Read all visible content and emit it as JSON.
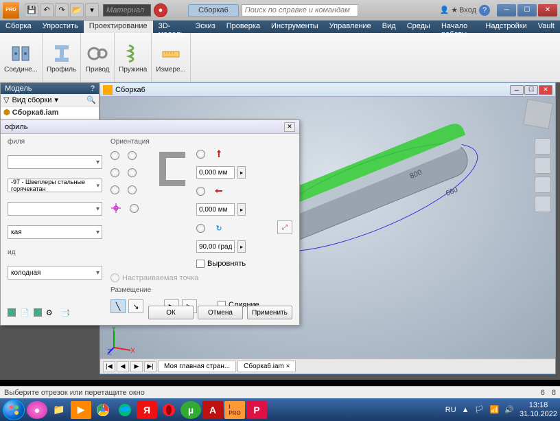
{
  "titlebar": {
    "material_placeholder": "Материал",
    "doc_tab": "Сборка6",
    "search_placeholder": "Поиск по справке и командам",
    "signin": "Вход"
  },
  "menus": [
    "Сборка",
    "Упростить",
    "Проектирование",
    "3D-модель",
    "Эскиз",
    "Проверка",
    "Инструменты",
    "Управление",
    "Вид",
    "Среды",
    "Начало работы",
    "Надстройки",
    "Vault"
  ],
  "active_menu": "Проектирование",
  "ribbon": [
    {
      "label": "Соедине..."
    },
    {
      "label": "Профиль"
    },
    {
      "label": "Привод"
    },
    {
      "label": "Пружина"
    },
    {
      "label": "Измере..."
    }
  ],
  "model_panel": {
    "title": "Модель",
    "view_label": "Вид сборки",
    "root": "Сборка6.iam"
  },
  "child_win": {
    "title": "Сборка6",
    "tabs_nav": [
      "|◀",
      "◀",
      "▶",
      "▶|"
    ],
    "tabs": [
      "Моя главная стран...",
      "Сборка6.iam ×"
    ]
  },
  "dialog": {
    "title": "офиль",
    "left_label": "филя",
    "combo_standard": "-97 - Швеллеры стальные горячекатан",
    "combo_empty": "",
    "combo_type": "кая",
    "combo_group_lbl": "ид",
    "combo_material": "колодная",
    "orientation_label": "Ориентация",
    "input1": "0,000 мм",
    "input2": "0,000 мм",
    "input3": "90,00 град",
    "align_label": "Выровнять",
    "custom_point": "Настраиваемая точка",
    "placement_label": "Размещение",
    "merge_label": "Слияние",
    "btn_ok": "ОК",
    "btn_cancel": "Отмена",
    "btn_apply": "Применить"
  },
  "statusbar": {
    "hint": "Выберите отрезок или перетащите окно",
    "num1": "6",
    "num2": "8"
  },
  "taskbar": {
    "lang": "RU",
    "time": "13:18",
    "date": "31.10.2022"
  }
}
